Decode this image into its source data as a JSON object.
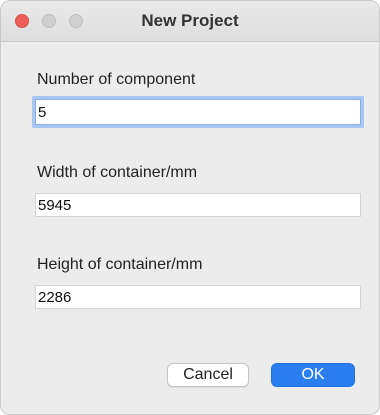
{
  "window": {
    "title": "New Project",
    "traffic_lights": {
      "close_color": "#ee5f5b",
      "inactive_color": "#cfcfcf"
    }
  },
  "form": {
    "fields": [
      {
        "label": "Number of component",
        "value": "5",
        "focused": true
      },
      {
        "label": "Width of container/mm",
        "value": "5945",
        "focused": false
      },
      {
        "label": "Height of container/mm",
        "value": "2286",
        "focused": false
      }
    ]
  },
  "buttons": {
    "cancel_label": "Cancel",
    "ok_label": "OK",
    "ok_color": "#2a7ef0"
  }
}
